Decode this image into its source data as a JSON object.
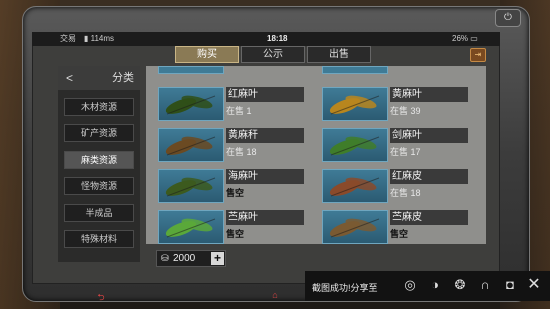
{
  "status_bar": {
    "app": "交易",
    "signal": "114ms",
    "time": "18:18",
    "battery": "26%"
  },
  "tabs": [
    {
      "label": "购买",
      "active": true
    },
    {
      "label": "公示",
      "active": false
    },
    {
      "label": "出售",
      "active": false
    }
  ],
  "sidebar": {
    "title": "分类",
    "back_icon": "chevron-left-icon",
    "items": [
      {
        "label": "木材资源",
        "active": false
      },
      {
        "label": "矿产资源",
        "active": false
      },
      {
        "label": "麻类资源",
        "active": true
      },
      {
        "label": "怪物资源",
        "active": false
      },
      {
        "label": "半成品",
        "active": false
      },
      {
        "label": "特殊材料",
        "active": false
      }
    ]
  },
  "items": [
    {
      "name": "红麻叶",
      "status": "在售 1",
      "sold_out": false,
      "leaf_color": "#2f4f18"
    },
    {
      "name": "黄麻叶",
      "status": "在售 39",
      "sold_out": false,
      "leaf_color": "#b8861e"
    },
    {
      "name": "黄麻秆",
      "status": "在售 18",
      "sold_out": false,
      "leaf_color": "#6b4a22"
    },
    {
      "name": "剑麻叶",
      "status": "在售 17",
      "sold_out": false,
      "leaf_color": "#3f7d2a"
    },
    {
      "name": "海麻叶",
      "status": "售空",
      "sold_out": true,
      "leaf_color": "#3c5a1e"
    },
    {
      "name": "红麻皮",
      "status": "在售 18",
      "sold_out": false,
      "leaf_color": "#8a4a2a"
    },
    {
      "name": "苎麻叶",
      "status": "售空",
      "sold_out": true,
      "leaf_color": "#5aa83a"
    },
    {
      "name": "苎麻皮",
      "status": "售空",
      "sold_out": true,
      "leaf_color": "#7a5a32"
    }
  ],
  "quantity": {
    "value": "2000",
    "plus_label": "+"
  },
  "share": {
    "label": "截图成功!分享至"
  },
  "colors": {
    "tab_active": "#8a7a55",
    "card_bg": "#3f7b96",
    "panel_bg": "#8f8f8c"
  }
}
